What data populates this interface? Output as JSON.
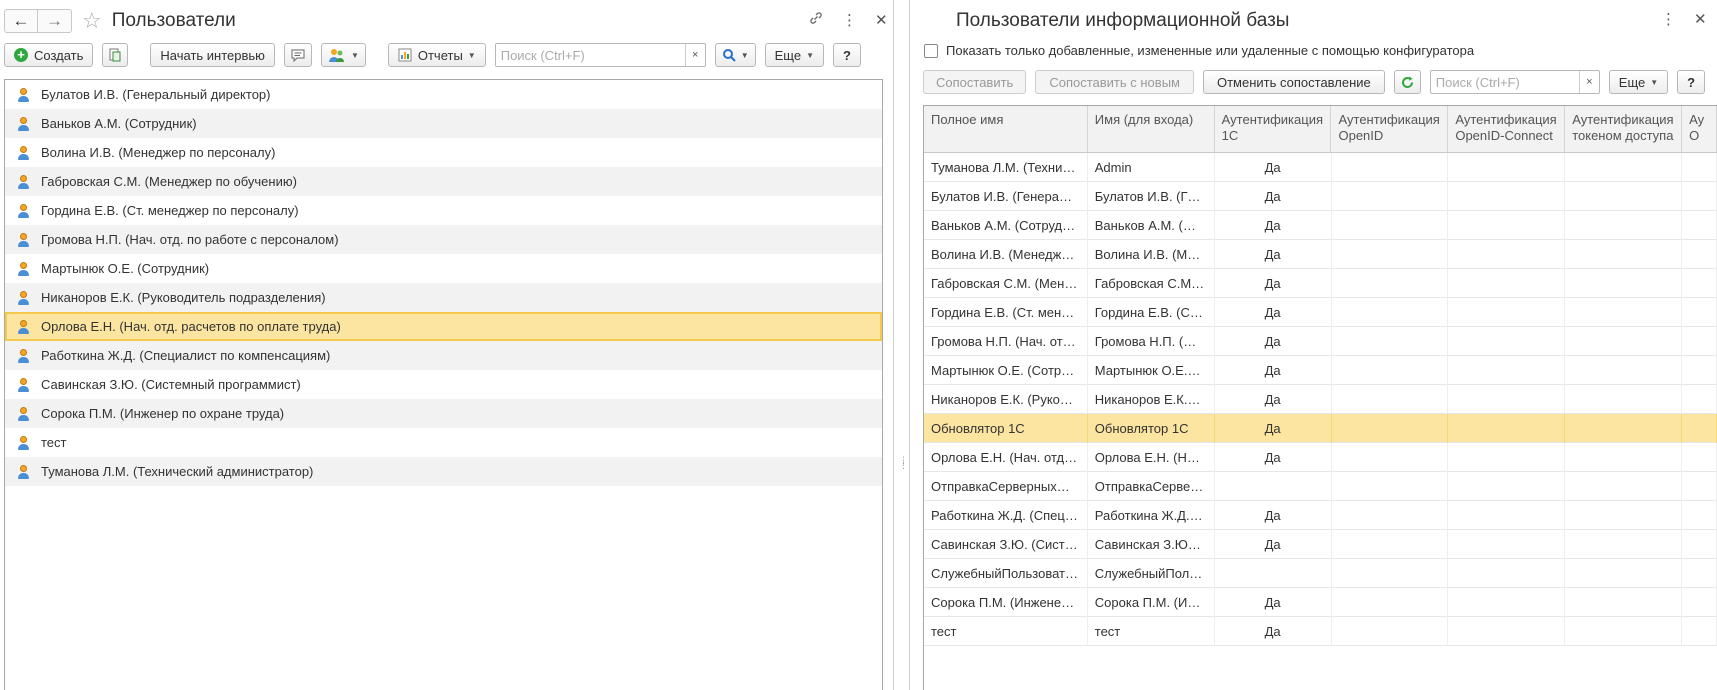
{
  "left": {
    "title": "Пользователи",
    "toolbar": {
      "create": "Создать",
      "interview": "Начать интервью",
      "reports": "Отчеты",
      "search_placeholder": "Поиск (Ctrl+F)",
      "clear": "×",
      "more": "Еще",
      "help": "?"
    },
    "users": [
      "Булатов И.В. (Генеральный директор)",
      "Ваньков А.М. (Сотрудник)",
      "Волина И.В. (Менеджер по персоналу)",
      "Габровская С.М. (Менеджер по обучению)",
      "Гордина Е.В. (Ст. менеджер по персоналу)",
      "Громова Н.П. (Нач. отд. по работе с персоналом)",
      "Мартынюк О.Е. (Сотрудник)",
      "Никаноров Е.К. (Руководитель подразделения)",
      "Орлова Е.Н. (Нач. отд. расчетов по оплате труда)",
      "Работкина Ж.Д. (Специалист по компенсациям)",
      "Савинская З.Ю. (Системный программист)",
      "Сорока П.М. (Инженер по охране труда)",
      "тест",
      "Туманова Л.М. (Технический администратор)"
    ],
    "selected_index": 8
  },
  "right": {
    "title": "Пользователи информационной базы",
    "checkbox_label": "Показать только добавленные, измененные или удаленные с помощью конфигуратора",
    "toolbar": {
      "match": "Сопоставить",
      "match_new": "Сопоставить с новым",
      "cancel_match": "Отменить сопоставление",
      "search_placeholder": "Поиск (Ctrl+F)",
      "clear": "×",
      "more": "Еще",
      "help": "?"
    },
    "columns": [
      "Полное имя",
      "Имя (для входа)",
      "Аутентификация 1С",
      "Аутентификация OpenID",
      "Аутентификация OpenID-Connect",
      "Аутентификация токеном доступа",
      "Ау О"
    ],
    "rows": [
      [
        "Туманова Л.М. (Техни…",
        "Admin",
        "Да"
      ],
      [
        "Булатов И.В. (Генера…",
        "Булатов И.В. (Г…",
        "Да"
      ],
      [
        "Ваньков А.М. (Сотруд…",
        "Ваньков А.М. (…",
        "Да"
      ],
      [
        "Волина И.В. (Менедж…",
        "Волина И.В. (М…",
        "Да"
      ],
      [
        "Габровская С.М. (Мен…",
        "Габровская С.М…",
        "Да"
      ],
      [
        "Гордина Е.В. (Ст. мен…",
        "Гордина Е.В. (С…",
        "Да"
      ],
      [
        "Громова Н.П. (Нач. от…",
        "Громова Н.П. (…",
        "Да"
      ],
      [
        "Мартынюк О.Е. (Сотр…",
        "Мартынюк О.Е.…",
        "Да"
      ],
      [
        "Никаноров Е.К. (Руко…",
        "Никаноров Е.К.…",
        "Да"
      ],
      [
        "Обновлятор 1С",
        "Обновлятор 1С",
        "Да"
      ],
      [
        "Орлова Е.Н. (Нач. отд…",
        "Орлова Е.Н. (Н…",
        "Да"
      ],
      [
        "ОтправкаСерверныхО…",
        "ОтправкаСерве…",
        ""
      ],
      [
        "Работкина Ж.Д. (Спец…",
        "Работкина Ж.Д.…",
        "Да"
      ],
      [
        "Савинская З.Ю. (Сист…",
        "Савинская З.Ю…",
        "Да"
      ],
      [
        "СлужебныйПользоват…",
        "СлужебныйПол…",
        ""
      ],
      [
        "Сорока П.М. (Инжене…",
        "Сорока П.М. (И…",
        "Да"
      ],
      [
        "тест",
        "тест",
        "Да"
      ]
    ],
    "selected_index": 9
  }
}
